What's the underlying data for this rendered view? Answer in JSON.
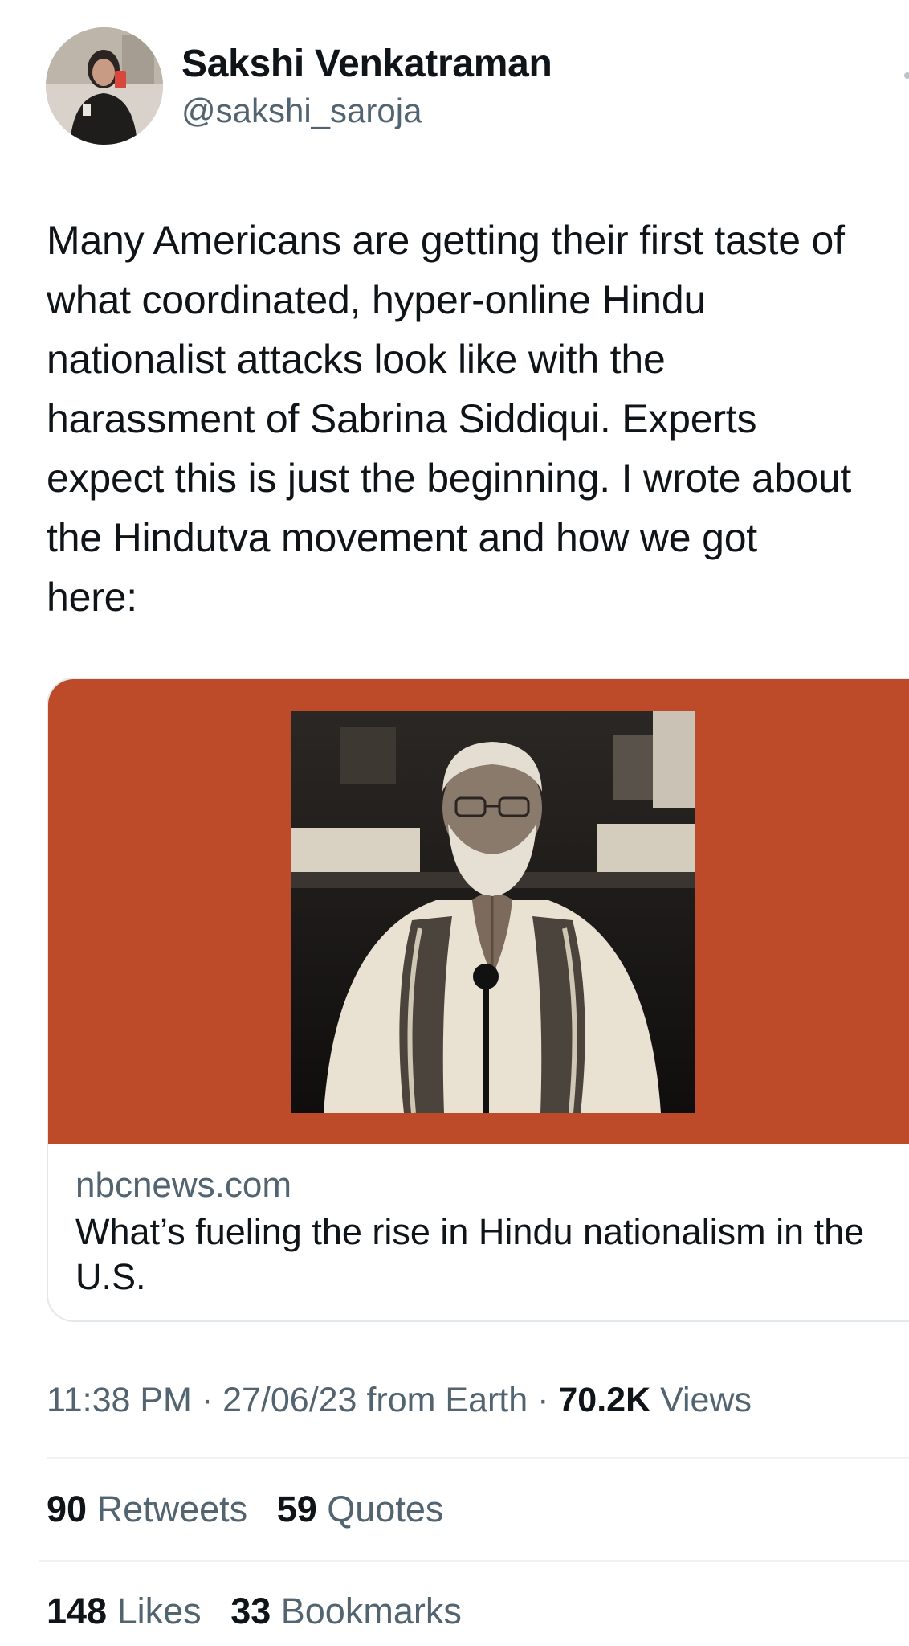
{
  "tweet": {
    "author": {
      "display_name": "Sakshi Venkatraman",
      "handle": "@sakshi_saroja"
    },
    "text": "Many Americans are getting their first taste of\nwhat coordinated, hyper-online Hindu\nnationalist attacks  look like with the\nharassment of Sabrina Siddiqui. Experts\nexpect this is just the beginning. I wrote about\nthe Hindutva movement and how we got\nhere:",
    "card": {
      "domain": "nbcnews.com",
      "title": "What’s fueling the rise in Hindu nationalism in the U.S.",
      "background_color": "#bd4a29"
    },
    "meta": {
      "time": "11:38 PM",
      "separator": " · ",
      "date": "27/06/23",
      "source": "from Earth",
      "views_count": "70.2K",
      "views_label": "Views"
    },
    "stats": {
      "retweets_count": "90",
      "retweets_label": "Retweets",
      "quotes_count": "59",
      "quotes_label": "Quotes",
      "likes_count": "148",
      "likes_label": "Likes",
      "bookmarks_count": "33",
      "bookmarks_label": "Bookmarks"
    }
  },
  "icons": {
    "more": "more-dots-icon"
  }
}
